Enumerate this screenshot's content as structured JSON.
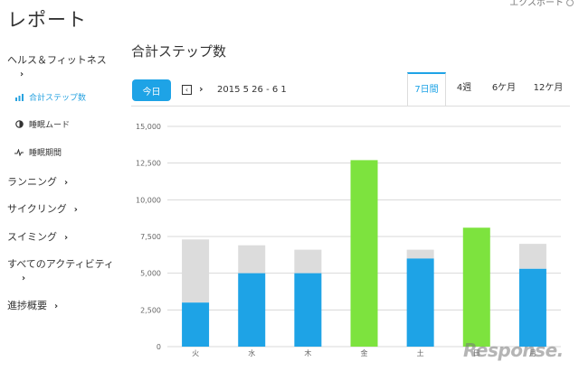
{
  "app": {
    "title": "レポート",
    "export_label": "エクスポート"
  },
  "sidebar": {
    "groups": [
      {
        "label": "ヘルス＆フィットネス"
      },
      {
        "label": "ランニング"
      },
      {
        "label": "サイクリング"
      },
      {
        "label": "スイミング"
      },
      {
        "label": "すべてのアクティビティ"
      },
      {
        "label": "進捗概要"
      }
    ],
    "sub_items": [
      {
        "label": "合計ステップ数",
        "icon": "bar-chart-icon",
        "active": true
      },
      {
        "label": "睡眠ムード",
        "icon": "moon-icon",
        "active": false
      },
      {
        "label": "睡眠期間",
        "icon": "pulse-icon",
        "active": false
      }
    ]
  },
  "main": {
    "title": "合計ステップ数",
    "today_label": "今日",
    "date_range": "2015 5 26 - 6 1",
    "tabs": [
      {
        "label": "7日間",
        "active": true
      },
      {
        "label": "4週",
        "active": false
      },
      {
        "label": "6ケ月",
        "active": false
      },
      {
        "label": "12ケ月",
        "active": false
      }
    ]
  },
  "watermark": "Response.",
  "colors": {
    "accent": "#1ea3e6",
    "bar_blue": "#1ea3e6",
    "bar_green": "#7de33e",
    "bar_goal": "#dcdcdc"
  },
  "chart_data": {
    "type": "bar",
    "categories": [
      "火",
      "水",
      "木",
      "金",
      "土",
      "日",
      "月"
    ],
    "ylim": [
      0,
      15000
    ],
    "yticks": [
      "0",
      "2,500",
      "5,000",
      "7,500",
      "10,000",
      "12,500",
      "15,000"
    ],
    "ytick_values": [
      0,
      2500,
      5000,
      7500,
      10000,
      12500,
      15000
    ],
    "series": [
      {
        "values": [
          3000,
          5000,
          5000,
          12700,
          6000,
          8100,
          5300
        ]
      }
    ],
    "goals": [
      7300,
      6900,
      6600,
      0,
      6600,
      0,
      7000
    ],
    "goal_reached": [
      false,
      false,
      false,
      true,
      false,
      true,
      false
    ],
    "grid": true
  }
}
